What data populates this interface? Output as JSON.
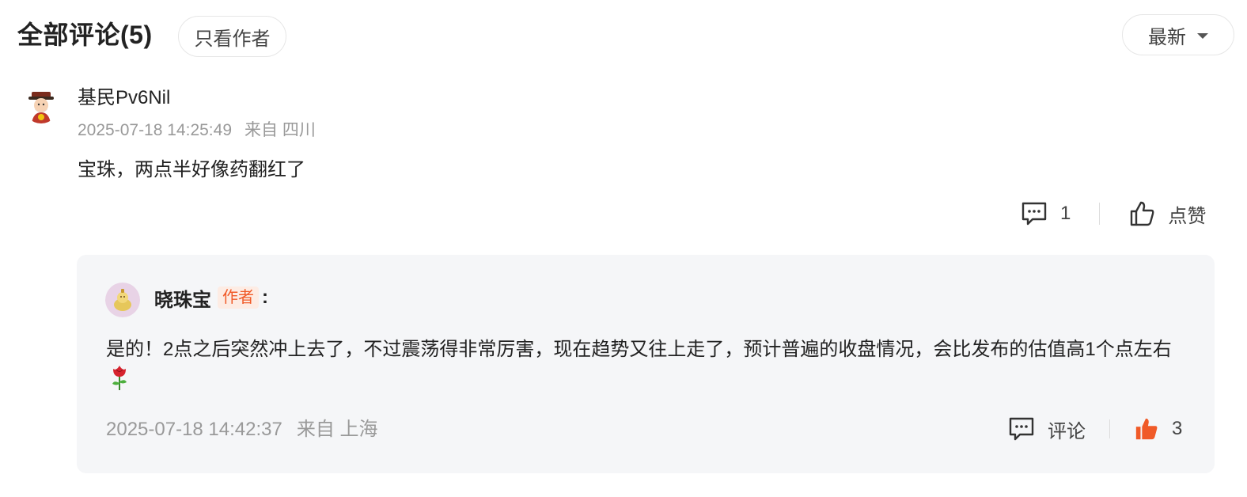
{
  "header": {
    "title": "全部评论(5)",
    "author_only_label": "只看作者",
    "sort_label": "最新"
  },
  "comment": {
    "username": "基民Pv6Nil",
    "timestamp": "2025-07-18 14:25:49",
    "location": "来自 四川",
    "text": "宝珠，两点半好像药翻红了",
    "reply_count": "1",
    "like_label": "点赞"
  },
  "reply": {
    "username": "晓珠宝",
    "author_tag": "作者",
    "colon": ":",
    "text": "是的！2点之后突然冲上去了，不过震荡得非常厉害，现在趋势又往上走了，预计普遍的收盘情况，会比发布的估值高1个点左右",
    "timestamp": "2025-07-18 14:42:37",
    "location": "来自 上海",
    "comment_label": "评论",
    "like_count": "3"
  },
  "icons": {
    "comment": "comment-icon",
    "like_outline": "thumbs-up-icon",
    "like_filled": "thumbs-up-filled-icon",
    "rose": "rose-emoji-icon",
    "caret": "caret-down-icon"
  },
  "colors": {
    "accent": "#f05a28",
    "reply_bg": "#f5f6f8",
    "meta_text": "#999999"
  }
}
